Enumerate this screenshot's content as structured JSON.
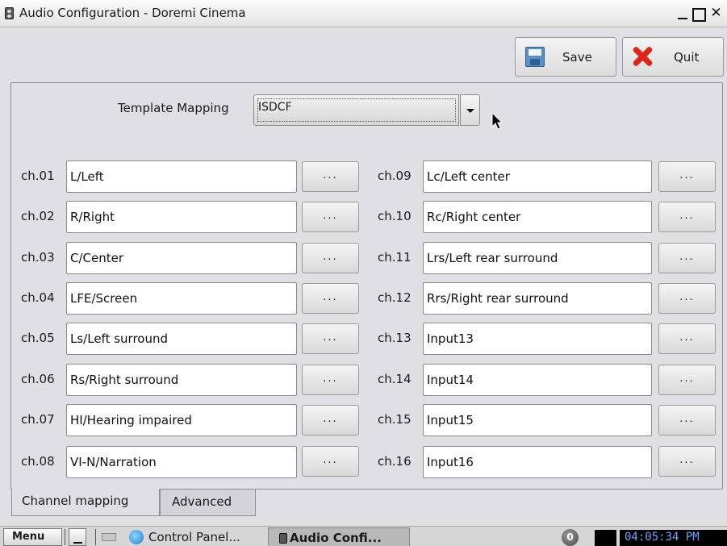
{
  "window": {
    "title": "Audio Configuration - Doremi Cinema",
    "buttons": {
      "minimize": "minimize",
      "maximize": "maximize",
      "close": "✕"
    }
  },
  "toolbar": {
    "save_label": "Save",
    "quit_label": "Quit"
  },
  "template": {
    "label": "Template Mapping",
    "value": "ISDCF"
  },
  "channels_left": [
    {
      "label": "ch.01",
      "value": "L/Left",
      "button": "..."
    },
    {
      "label": "ch.02",
      "value": "R/Right",
      "button": "..."
    },
    {
      "label": "ch.03",
      "value": "C/Center",
      "button": "..."
    },
    {
      "label": "ch.04",
      "value": "LFE/Screen",
      "button": "..."
    },
    {
      "label": "ch.05",
      "value": "Ls/Left surround",
      "button": "..."
    },
    {
      "label": "ch.06",
      "value": "Rs/Right surround",
      "button": "..."
    },
    {
      "label": "ch.07",
      "value": "HI/Hearing impaired",
      "button": "..."
    },
    {
      "label": "ch.08",
      "value": "VI-N/Narration",
      "button": "..."
    }
  ],
  "channels_right": [
    {
      "label": "ch.09",
      "value": "Lc/Left center",
      "button": "..."
    },
    {
      "label": "ch.10",
      "value": "Rc/Right center",
      "button": "..."
    },
    {
      "label": "ch.11",
      "value": "Lrs/Left rear surround",
      "button": "..."
    },
    {
      "label": "ch.12",
      "value": "Rrs/Right rear surround",
      "button": "..."
    },
    {
      "label": "ch.13",
      "value": "Input13",
      "button": "..."
    },
    {
      "label": "ch.14",
      "value": "Input14",
      "button": "..."
    },
    {
      "label": "ch.15",
      "value": "Input15",
      "button": "..."
    },
    {
      "label": "ch.16",
      "value": "Input16",
      "button": "..."
    }
  ],
  "tabs": [
    {
      "label": "Channel mapping",
      "active": true
    },
    {
      "label": "Advanced",
      "active": false
    }
  ],
  "taskbar": {
    "menu_label": "Menu",
    "tasks": [
      {
        "label": "Control Panel..."
      },
      {
        "label": "Audio Confi..."
      }
    ],
    "notification_badge": "0",
    "clock": "04:05:34 PM"
  }
}
